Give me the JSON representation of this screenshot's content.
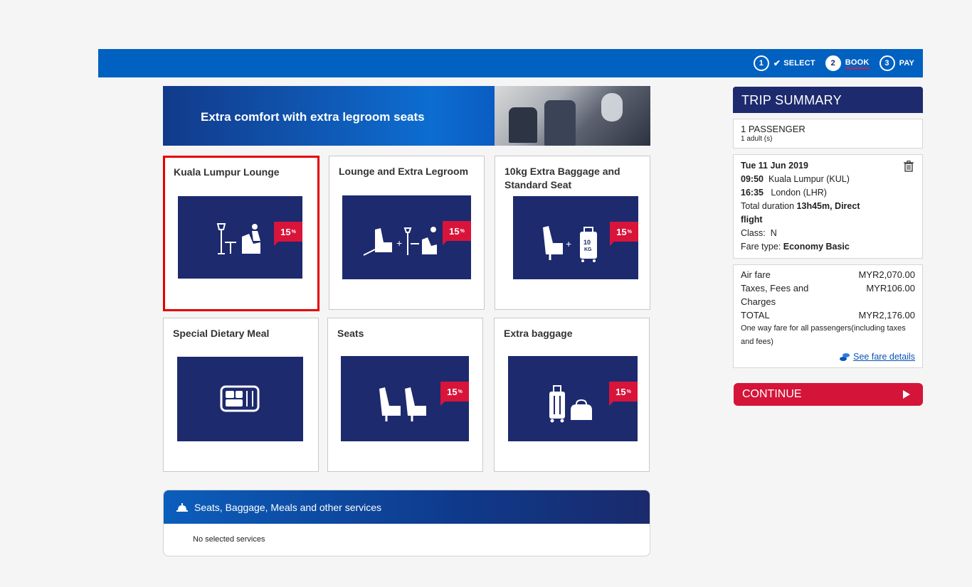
{
  "steps": [
    {
      "num": "1",
      "label": "SELECT"
    },
    {
      "num": "2",
      "label": "BOOK"
    },
    {
      "num": "3",
      "label": "PAY"
    }
  ],
  "banner": {
    "text": "Extra comfort with extra legroom seats"
  },
  "cards": [
    {
      "title": "Kuala Lumpur Lounge",
      "badge": "15",
      "selected": true
    },
    {
      "title": "Lounge and Extra Legroom",
      "badge": "15"
    },
    {
      "title": "10kg Extra Baggage and Standard Seat",
      "badge": "15",
      "bag_label_top": "10",
      "bag_label_bottom": "KG"
    },
    {
      "title": "Special Dietary Meal"
    },
    {
      "title": "Seats",
      "badge": "15"
    },
    {
      "title": "Extra baggage",
      "badge": "15"
    }
  ],
  "badge_suffix": "%",
  "badge_off": "OFF",
  "services": {
    "title": "Seats, Baggage, Meals and other services",
    "empty_text": "No selected services"
  },
  "summary": {
    "title": "TRIP SUMMARY",
    "passengers": "1 PASSENGER",
    "passengers_sub": "1 adult (s)",
    "date": "Tue 11 Jun 2019",
    "dep_time": "09:50",
    "dep_place": "Kuala Lumpur (KUL)",
    "arr_time": "16:35",
    "arr_place": "London (LHR)",
    "duration_label": "Total  duration",
    "duration_value": "13h45m, Direct flight",
    "class_label": "Class:",
    "class_value": "N",
    "fare_type_label": "Fare type:",
    "fare_type_value": "Economy Basic",
    "fares": [
      {
        "label": "Air fare",
        "value": "MYR2,070.00"
      },
      {
        "label": "Taxes, Fees and Charges",
        "value": "MYR106.00"
      },
      {
        "label": "TOTAL",
        "value": "MYR2,176.00"
      }
    ],
    "fare_note": "One way fare for all passengers(including taxes and fees)",
    "fare_link": "See fare details"
  },
  "continue_label": "CONTINUE",
  "colors": {
    "brand_blue": "#0061c1",
    "navy": "#1d2a6e",
    "accent_red": "#d51439",
    "selected_border": "#e60000"
  }
}
